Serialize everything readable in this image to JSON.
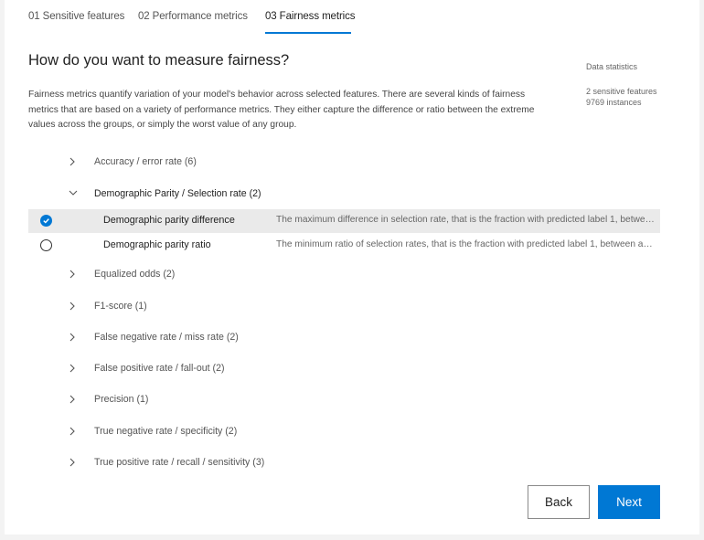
{
  "tabs": [
    {
      "label": "01 Sensitive features"
    },
    {
      "label": "02 Performance metrics"
    },
    {
      "label": "03 Fairness metrics"
    }
  ],
  "header": {
    "title": "How do you want to measure fairness?",
    "description": "Fairness metrics quantify variation of your model's behavior across selected features. There are several kinds of fairness metrics that are based on a variety of performance metrics. They either capture the difference or ratio between the extreme values across the groups, or simply the worst value of any group."
  },
  "stats": {
    "title": "Data statistics",
    "features": "2 sensitive features",
    "instances": "9769 instances"
  },
  "groups": [
    {
      "label": "Accuracy / error rate (6)",
      "expanded": false
    },
    {
      "label": "Demographic Parity / Selection rate (2)",
      "expanded": true,
      "metrics": [
        {
          "name": "Demographic parity difference",
          "description": "The maximum difference in selection rate, that is the fraction with predicted label 1, between any two groups.",
          "selected": true
        },
        {
          "name": "Demographic parity ratio",
          "description": "The minimum ratio of selection rates, that is the fraction with predicted label 1, between any two groups.",
          "selected": false
        }
      ]
    },
    {
      "label": "Equalized odds (2)",
      "expanded": false
    },
    {
      "label": "F1-score (1)",
      "expanded": false
    },
    {
      "label": "False negative rate / miss rate (2)",
      "expanded": false
    },
    {
      "label": "False positive rate / fall-out (2)",
      "expanded": false
    },
    {
      "label": "Precision (1)",
      "expanded": false
    },
    {
      "label": "True negative rate / specificity (2)",
      "expanded": false
    },
    {
      "label": "True positive rate / recall / sensitivity (3)",
      "expanded": false
    }
  ],
  "buttons": {
    "back": "Back",
    "next": "Next"
  },
  "colors": {
    "accent": "#0078d4",
    "selected_row": "#eaeaea"
  }
}
